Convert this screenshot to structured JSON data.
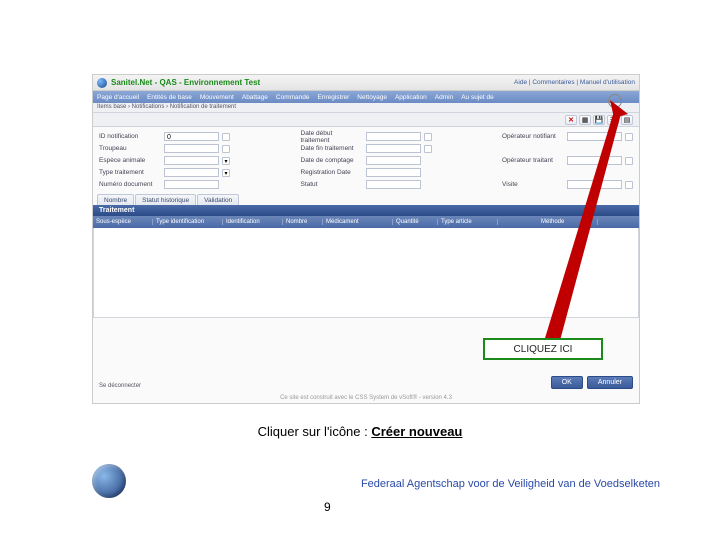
{
  "title": "Sanitel.Net - QAS - Environnement Test",
  "header_links": "Aide | Commentaires | Manuel d'utilisation",
  "menu": [
    "Page d'accueil",
    "Entités de base",
    "Mouvement",
    "Abattage",
    "Commande",
    "Enregistrer",
    "Nettoyage",
    "Application",
    "Admin",
    "Au sujet de"
  ],
  "breadcrumb": "Items base › Notifications › Notification de traitement",
  "icons": {
    "close": "✕",
    "save": "💾",
    "new": "▦",
    "list": "☰",
    "print": "▤"
  },
  "form": {
    "col1": [
      {
        "label": "ID notification",
        "value": "0",
        "picker": true
      },
      {
        "label": "Troupeau",
        "value": "",
        "picker": true
      },
      {
        "label": "Espèce animale",
        "value": "",
        "select": true
      },
      {
        "label": "Type traitement",
        "value": "",
        "select": true
      },
      {
        "label": "Numéro document",
        "value": ""
      }
    ],
    "col2": [
      {
        "label": "Date début traitement",
        "value": "",
        "picker": true
      },
      {
        "label": "Date fin traitement",
        "value": "",
        "picker": true
      },
      {
        "label": "Date de comptage",
        "value": ""
      },
      {
        "label": "Registration Date",
        "value": ""
      },
      {
        "label": "Statut",
        "value": ""
      }
    ],
    "col3": [
      {
        "label": "Opérateur notifiant",
        "value": "",
        "picker": true
      },
      {
        "label": "",
        "value": ""
      },
      {
        "label": "Opérateur traitant",
        "value": "",
        "picker": true
      },
      {
        "label": "",
        "value": ""
      },
      {
        "label": "Visite",
        "value": "",
        "picker": true
      }
    ]
  },
  "tabs": [
    {
      "label": "Nombre",
      "active": false
    },
    {
      "label": "Statut historique",
      "active": false
    },
    {
      "label": "Validation",
      "active": false
    }
  ],
  "section_title": "Traitement",
  "columns": [
    "Sous-espèce",
    "Type identification",
    "Identification",
    "Nombre",
    "Médicament",
    "Quantité",
    "Type article",
    "",
    "Méthode"
  ],
  "buttons": {
    "ok": "OK",
    "cancel": "Annuler"
  },
  "se_link": "Se déconnecter",
  "footer": "Ce site est construit avec le CSS System de vSoft® - version 4.3",
  "callout": "CLIQUEZ  ICI",
  "caption_pre": "Cliquer sur l'icône : ",
  "caption_bold": "Créer nouveau",
  "agency": "Federaal Agentschap voor de Veiligheid van de Voedselketen",
  "page": "9"
}
